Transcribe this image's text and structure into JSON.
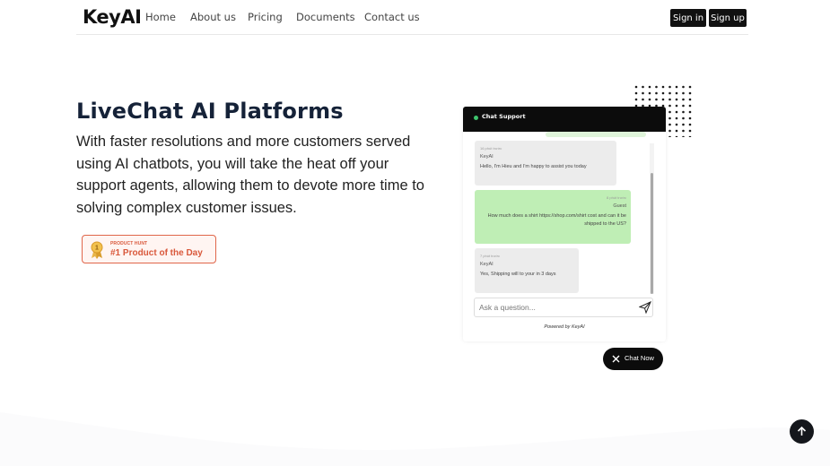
{
  "header": {
    "logo": "KeyAI",
    "nav": [
      "Home",
      "About us",
      "Pricing",
      "Documents",
      "Contact us"
    ],
    "sign_in": "Sign in",
    "sign_up": "Sign up"
  },
  "hero": {
    "title": "LiveChat AI Platforms",
    "description": "With faster resolutions and more customers served using AI chatbots, you will take the heat off your support agents, allowing them to devote more time to solving complex customer issues.",
    "badge_small": "PRODUCT HUNT",
    "badge_big": "#1 Product of the Day"
  },
  "chat": {
    "title": "Chat Support",
    "messages": [
      {
        "time": "16 phút trước",
        "name": "KeyAI",
        "text": "Hello, I'm Hieu and I'm happy to assist you today"
      },
      {
        "time": "8 phút trước",
        "name": "Guest",
        "text": "How much does a shirt https://shop.com/shirt cost and can it be shipped to the US?"
      },
      {
        "time": "7 phút trước",
        "name": "KeyAI",
        "text": "Yes, Shipping will to your in 3 days"
      }
    ],
    "input_placeholder": "Ask a question...",
    "powered": "Powered by KeyAI",
    "chat_now": "Chat Now"
  },
  "colors": {
    "accent": "#0c0c0c",
    "guest_bubble": "#bfeeb5",
    "bot_bubble": "#ececec",
    "badge": "#d9583b"
  }
}
